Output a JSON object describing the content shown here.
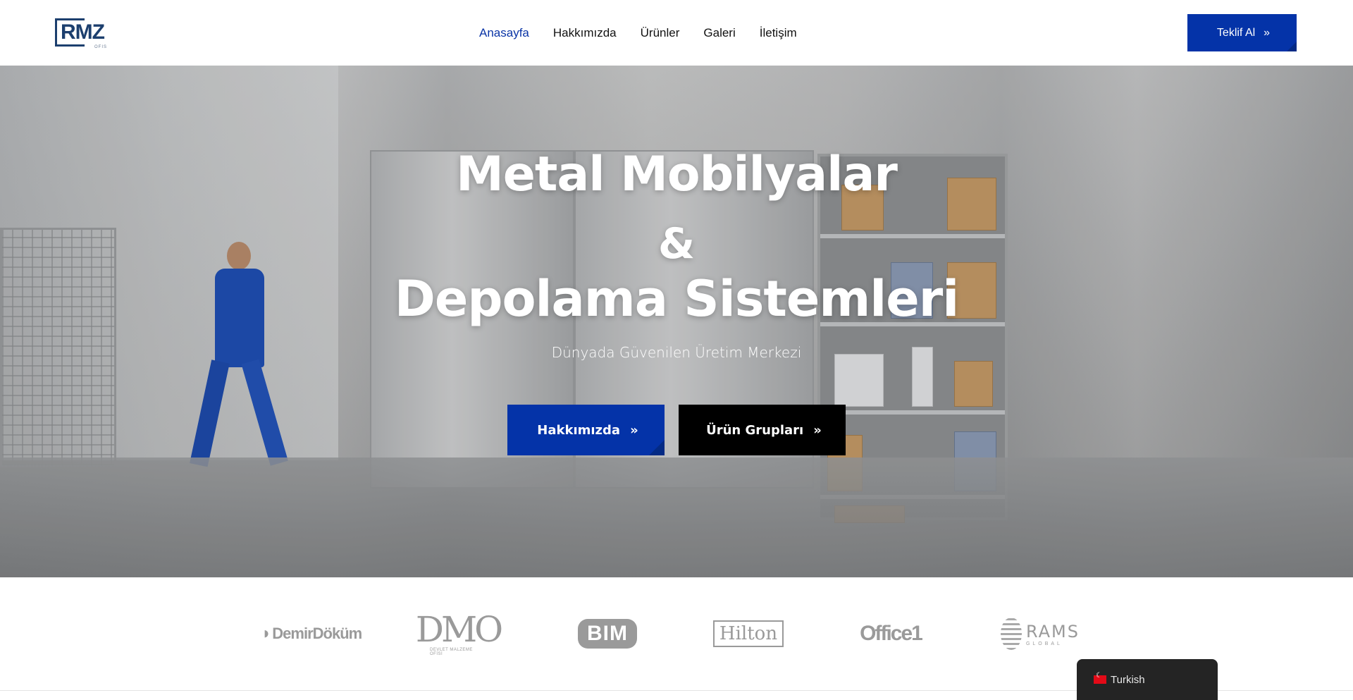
{
  "brand": {
    "logo_text": "RMZ",
    "logo_sub": "OFIS"
  },
  "nav": {
    "items": [
      {
        "label": "Anasayfa",
        "active": true
      },
      {
        "label": "Hakkımızda"
      },
      {
        "label": "Ürünler"
      },
      {
        "label": "Galeri"
      },
      {
        "label": "İletişim"
      }
    ],
    "cta_label": "Teklif Al"
  },
  "hero": {
    "title_line1": "Metal Mobilyalar",
    "title_line2": "&",
    "title_line3": "Depolama Sistemleri",
    "subtitle": "Dünyada Güvenilen Üretim Merkezi",
    "button_about": "Hakkımızda",
    "button_products": "Ürün Grupları"
  },
  "brands": {
    "demirdokum": "DemirDöküm",
    "dmo": "DMO",
    "dmo_sub": "DEVLET MALZEME OFİSİ",
    "bim": "BIM",
    "hilton": "Hilton",
    "office1": "Office1",
    "rams": "RAMS",
    "rams_sub": "GLOBAL"
  },
  "language": {
    "label": "Turkish"
  },
  "colors": {
    "accent": "#0433a8",
    "dark_button": "#000000",
    "logo": "#1c3f6e"
  }
}
